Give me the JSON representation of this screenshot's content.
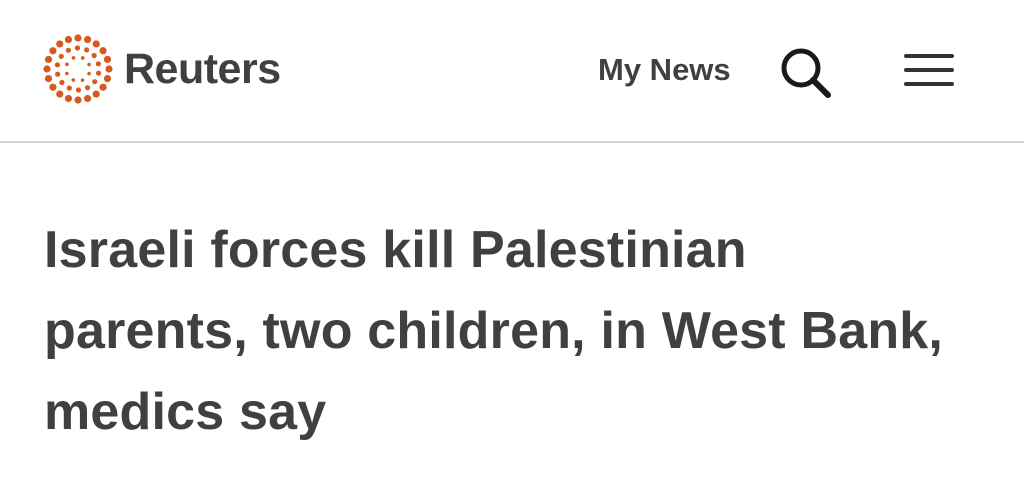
{
  "header": {
    "brand": "Reuters",
    "logo_icon": "reuters-dot-ring-logo",
    "my_news_label": "My News",
    "search_icon": "search-icon",
    "menu_icon": "hamburger-menu-icon"
  },
  "article": {
    "headline": "Israeli forces kill Palestinian parents, two children, in West Bank, medics say"
  },
  "colors": {
    "brand_orange": "#d9581f",
    "text_dark": "#404040",
    "divider": "#d4d4d4"
  }
}
